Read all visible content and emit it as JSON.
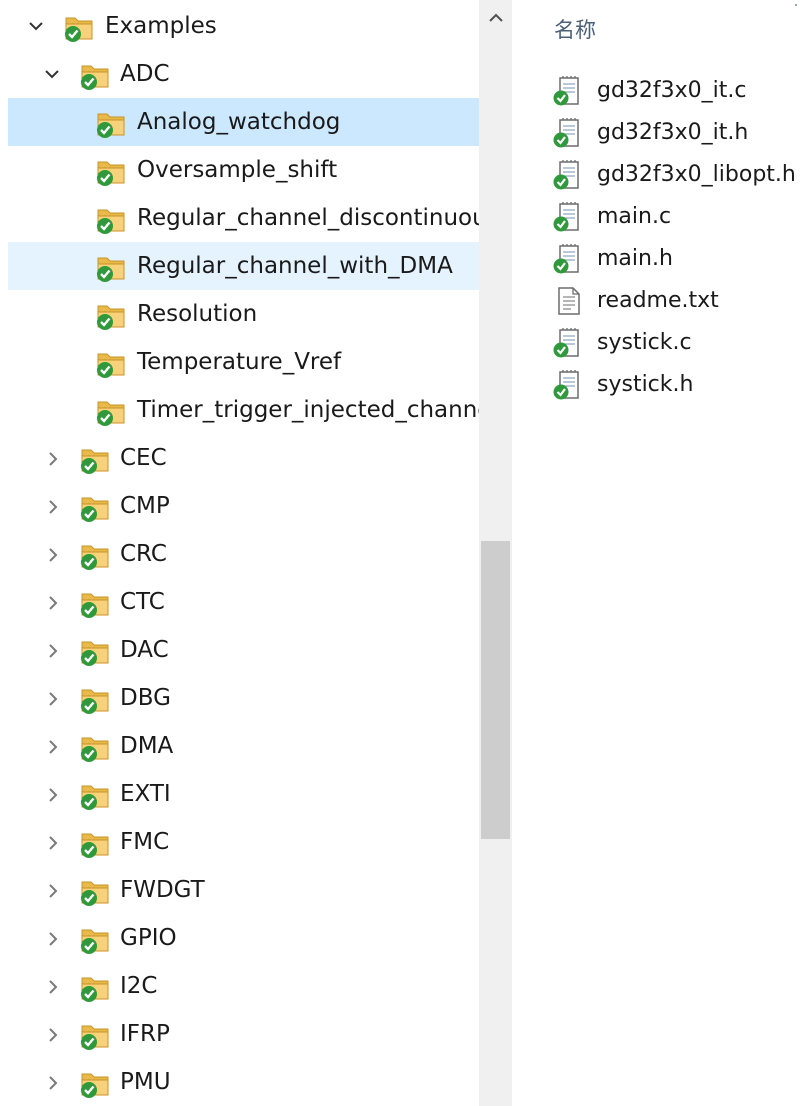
{
  "navigation_tree": {
    "root": {
      "label": "Examples",
      "expanded": true
    },
    "adc": {
      "label": "ADC",
      "expanded": true
    },
    "adc_children": [
      {
        "label": "Analog_watchdog",
        "state": "selected"
      },
      {
        "label": "Oversample_shift",
        "state": ""
      },
      {
        "label": "Regular_channel_discontinuous",
        "state": ""
      },
      {
        "label": "Regular_channel_with_DMA",
        "state": "hover"
      },
      {
        "label": "Resolution",
        "state": ""
      },
      {
        "label": "Temperature_Vref",
        "state": ""
      },
      {
        "label": "Timer_trigger_injected_channel",
        "state": ""
      }
    ],
    "siblings": [
      {
        "label": "CEC"
      },
      {
        "label": "CMP"
      },
      {
        "label": "CRC"
      },
      {
        "label": "CTC"
      },
      {
        "label": "DAC"
      },
      {
        "label": "DBG"
      },
      {
        "label": "DMA"
      },
      {
        "label": "EXTI"
      },
      {
        "label": "FMC"
      },
      {
        "label": "FWDGT"
      },
      {
        "label": "GPIO"
      },
      {
        "label": "I2C"
      },
      {
        "label": "IFRP"
      },
      {
        "label": "PMU"
      }
    ]
  },
  "file_list": {
    "column_header": "名称",
    "files": [
      {
        "name": "gd32f3x0_it.c",
        "icon": "source-file-icon"
      },
      {
        "name": "gd32f3x0_it.h",
        "icon": "source-file-icon"
      },
      {
        "name": "gd32f3x0_libopt.h",
        "icon": "source-file-icon"
      },
      {
        "name": "main.c",
        "icon": "source-file-icon"
      },
      {
        "name": "main.h",
        "icon": "source-file-icon"
      },
      {
        "name": "readme.txt",
        "icon": "text-file-icon"
      },
      {
        "name": "systick.c",
        "icon": "source-file-icon"
      },
      {
        "name": "systick.h",
        "icon": "source-file-icon"
      }
    ]
  },
  "colors": {
    "selected_row": "#cce8ff",
    "hover_row": "#e5f3ff",
    "folder": "#e9b94a",
    "sync_check": "#2f9a3b",
    "header_text": "#4c607a"
  }
}
